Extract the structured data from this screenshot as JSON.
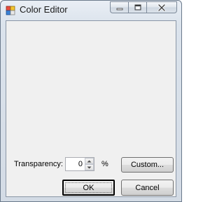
{
  "window": {
    "title": "Color Editor",
    "caption_buttons": [
      "minimize-icon",
      "maximize-icon",
      "close-icon"
    ]
  },
  "form": {
    "transparency_label": "Transparency:",
    "transparency_value": "0",
    "percent_label": "%",
    "custom_button": "Custom...",
    "ok_button": "OK",
    "cancel_button": "Cancel"
  },
  "colors": {
    "client_background": "#f0f0f0",
    "title_bar": "#dbe3ec",
    "close_hover": "#c75050"
  }
}
